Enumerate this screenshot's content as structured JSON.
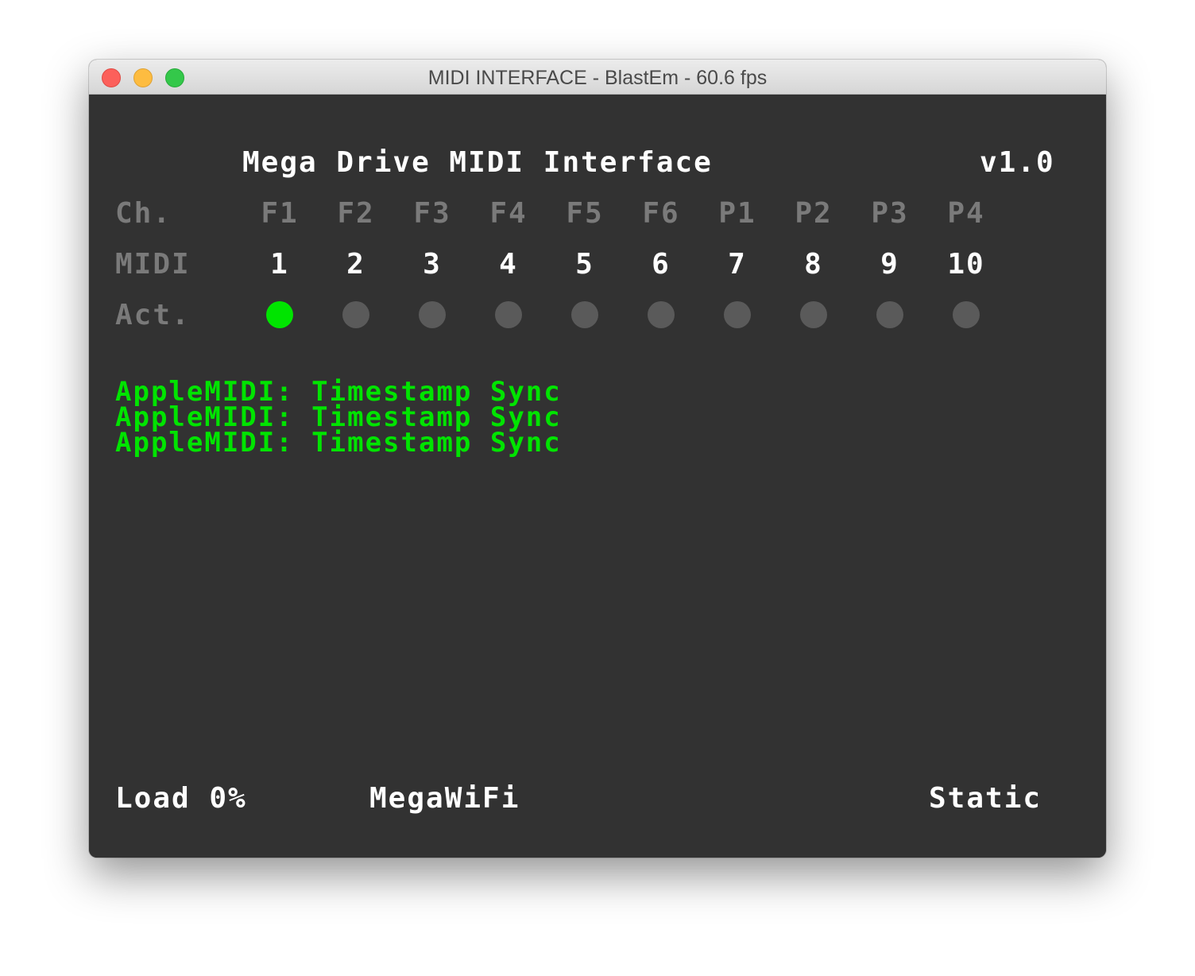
{
  "window": {
    "title": "MIDI INTERFACE - BlastEm - 60.6 fps"
  },
  "header": {
    "title": "Mega Drive MIDI Interface",
    "version": "v1.0"
  },
  "row_labels": {
    "channel": "Ch.",
    "midi": "MIDI",
    "activity": "Act."
  },
  "channels": [
    {
      "name": "F1",
      "midi": "1",
      "active": true
    },
    {
      "name": "F2",
      "midi": "2",
      "active": false
    },
    {
      "name": "F3",
      "midi": "3",
      "active": false
    },
    {
      "name": "F4",
      "midi": "4",
      "active": false
    },
    {
      "name": "F5",
      "midi": "5",
      "active": false
    },
    {
      "name": "F6",
      "midi": "6",
      "active": false
    },
    {
      "name": "P1",
      "midi": "7",
      "active": false
    },
    {
      "name": "P2",
      "midi": "8",
      "active": false
    },
    {
      "name": "P3",
      "midi": "9",
      "active": false
    },
    {
      "name": "P4",
      "midi": "10",
      "active": false
    }
  ],
  "log": [
    "AppleMIDI: Timestamp Sync",
    "AppleMIDI: Timestamp Sync",
    "AppleMIDI: Timestamp Sync"
  ],
  "status": {
    "load": "Load 0%",
    "network": "MegaWiFi",
    "mode": "Static"
  },
  "colors": {
    "background": "#323232",
    "text": "#ffffff",
    "label": "#7a7a7a",
    "active": "#00e400",
    "inactive": "#5a5a5a"
  }
}
